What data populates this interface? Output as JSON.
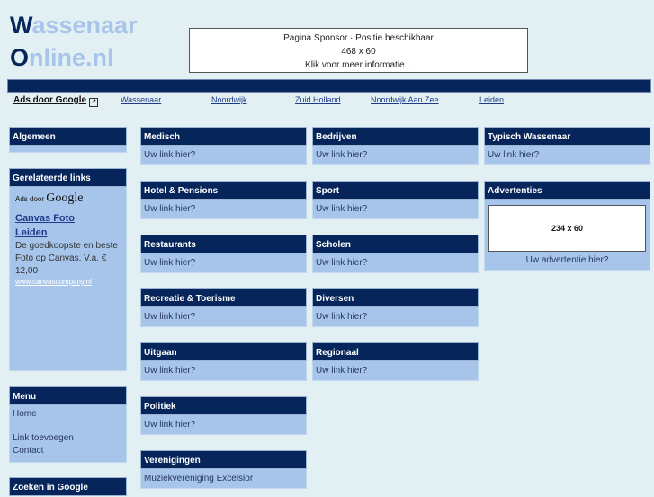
{
  "logo": {
    "line1_cap": "W",
    "line1_rest": "assenaar",
    "line2_cap": "O",
    "line2_rest": "nline.nl"
  },
  "sponsor": {
    "line1": "Pagina Sponsor · Positie beschikbaar",
    "line2": "468 x 60",
    "line3": "Klik voor meer informatie..."
  },
  "ads_row": {
    "ads_label": "Ads door Google",
    "links": [
      "Wassenaar",
      "Noordwijk",
      "Zuid Holland",
      "Noordwijk Aan Zee",
      "Leiden"
    ]
  },
  "sidebar": {
    "algemeen": {
      "title": "Algemeen"
    },
    "gerelateerde": {
      "title": "Gerelateerde links",
      "ads_prefix": "Ads door",
      "ads_brand": "Google",
      "ad": {
        "title_line1": "Canvas Foto",
        "title_line2": "Leiden",
        "text": "De goedkoopste en beste Foto op Canvas. V.a. € 12,00",
        "url": "www.canvascompany.nl"
      }
    },
    "menu": {
      "title": "Menu",
      "items": [
        "Home",
        "",
        "Link toevoegen",
        "Contact"
      ]
    },
    "zoeken": {
      "title": "Zoeken in Google"
    }
  },
  "categories": {
    "medisch": {
      "title": "Medisch",
      "link": "Uw link hier?"
    },
    "bedrijven": {
      "title": "Bedrijven",
      "link": "Uw link hier?"
    },
    "typisch": {
      "title": "Typisch Wassenaar",
      "link": "Uw link hier?"
    },
    "hotel": {
      "title": "Hotel & Pensions",
      "link": "Uw link hier?"
    },
    "sport": {
      "title": "Sport",
      "link": "Uw link hier?"
    },
    "restaurants": {
      "title": "Restaurants",
      "link": "Uw link hier?"
    },
    "scholen": {
      "title": "Scholen",
      "link": "Uw link hier?"
    },
    "recreatie": {
      "title": "Recreatie & Toerisme",
      "link": "Uw link hier?"
    },
    "diversen": {
      "title": "Diversen",
      "link": "Uw link hier?"
    },
    "uitgaan": {
      "title": "Uitgaan",
      "link": "Uw link hier?"
    },
    "regionaal": {
      "title": "Regionaal",
      "link": "Uw link hier?"
    },
    "politiek": {
      "title": "Politiek",
      "link": "Uw link hier?"
    },
    "verenigingen": {
      "title": "Verenigingen",
      "link": "Muziekvereniging Excelsior"
    }
  },
  "advertenties": {
    "title": "Advertenties",
    "banner": "234 x 60",
    "cta": "Uw advertentie hier?"
  }
}
